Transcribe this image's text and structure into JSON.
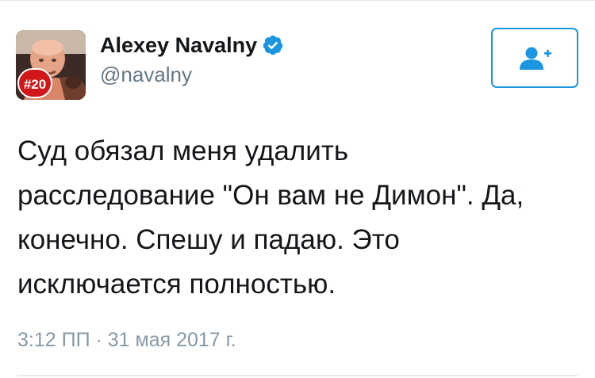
{
  "author": {
    "display_name": "Alexey Navalny",
    "handle": "@navalny",
    "verified": true,
    "avatar_badge": "#20"
  },
  "follow_button": {
    "icon": "add-user-icon"
  },
  "tweet": {
    "lines": [
      "Суд обязал меня удалить",
      "расследование \"Он вам не Димон\". Да,",
      "конечно. Спешу и падаю. Это",
      "исключается полностью."
    ],
    "timestamp": "3:12 ПП · 31 мая 2017 г."
  },
  "colors": {
    "accent": "#1b95e0",
    "text": "#14171a",
    "secondary": "#657786",
    "timestamp": "#8899a6",
    "badge": "#d0181b"
  }
}
